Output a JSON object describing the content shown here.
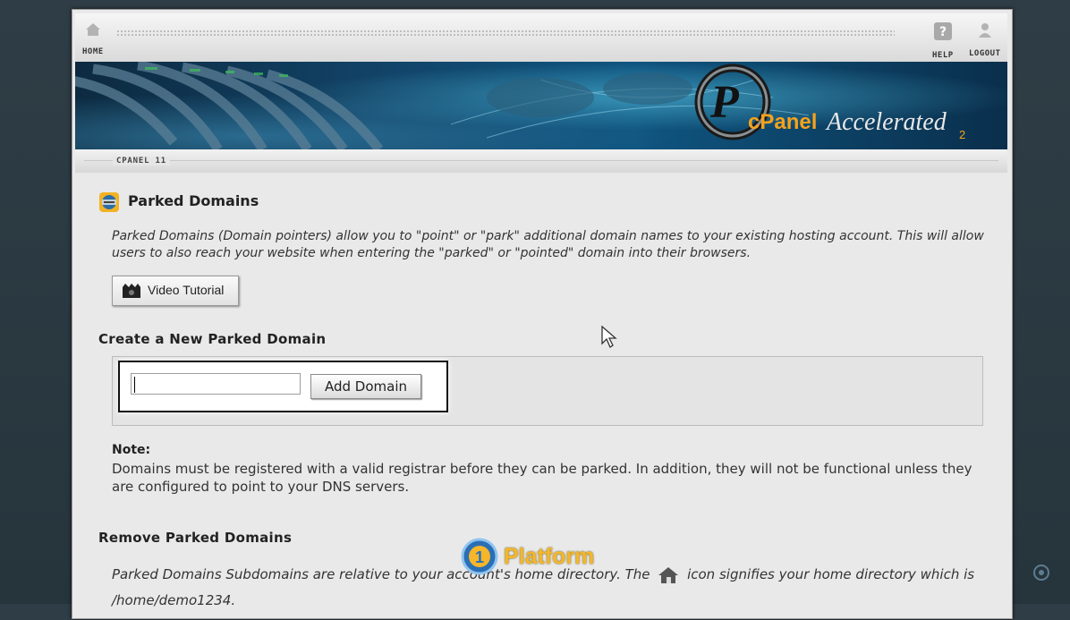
{
  "topbar": {
    "home_label": "HOME",
    "help_label": "HELP",
    "logout_label": "LOGOUT"
  },
  "banner": {
    "brand_cpanel": "cPanel",
    "brand_accelerated": "Accelerated",
    "brand_version": "2"
  },
  "breadcrumb": "CPANEL 11",
  "page": {
    "title": "Parked Domains",
    "intro": "Parked Domains (Domain pointers) allow you to \"point\" or \"park\" additional domain names to your existing hosting account. This will allow users to also reach your website when entering the \"parked\" or \"pointed\" domain into their browsers.",
    "video_button": "Video Tutorial"
  },
  "create": {
    "heading": "Create a New Parked Domain",
    "input_value": "",
    "add_button": "Add Domain"
  },
  "note": {
    "heading": "Note:",
    "text": "Domains must be registered with a valid registrar before they can be parked. In addition, they will not be functional unless they are configured to point to your DNS servers."
  },
  "remove": {
    "heading": "Remove Parked Domains",
    "text_before_icon": "Parked Domains Subdomains are relative to your account's home directory. The",
    "text_after_icon": "icon signifies your home directory which is /home/demo1234."
  },
  "watermark": {
    "text": "Platform"
  }
}
